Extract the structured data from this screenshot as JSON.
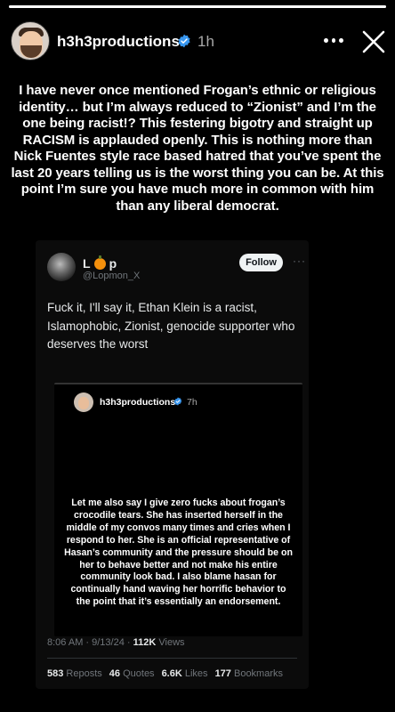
{
  "story": {
    "progress": 1.0,
    "username": "h3h3productions",
    "time": "1h",
    "verified": true,
    "caption": "I have never once mentioned Frogan’s ethnic or religious identity… but I’m always reduced to “Zionist” and I’m the one being racist!? This festering bigotry and straight up RACISM is applauded openly. This is nothing more than Nick Fuentes style race based hatred that you’ve spent the last 20 years telling us is the worst thing you can be. At this point I’m sure you have much more in common with him than any liberal democrat."
  },
  "tweet": {
    "name": "L",
    "name_suffix": "p",
    "handle": "@Lopmon_X",
    "follow_label": "Follow",
    "text": "Fuck it, I'll say it, Ethan Klein is a racist, Islamophobic, Zionist, genocide supporter who deserves the worst",
    "embed": {
      "username": "h3h3productions",
      "time": "7h",
      "text": "Let me also say I give zero fucks about frogan’s crocodile tears. She has inserted herself in the middle of my convos many times and cries when I respond to her. She is an official representative of Hasan’s community and the pressure should be on her to behave better and not make his entire community look bad. I also blame hasan for continually hand waving her horrific behavior to the point that it’s essentially an endorsement."
    },
    "timestamp": "8:06 AM · 9/13/24 · ",
    "views_count": "112K",
    "views_label": " Views",
    "stats": {
      "reposts_count": "583",
      "reposts_label": "Reposts",
      "quotes_count": "46",
      "quotes_label": "Quotes",
      "likes_count": "6.6K",
      "likes_label": "Likes",
      "bookmarks_count": "177",
      "bookmarks_label": "Bookmarks"
    }
  },
  "colors": {
    "background": "#000000",
    "verified_blue": "#3897f0",
    "follow_bg": "#eff3f4",
    "muted": "#71767b"
  },
  "icons": [
    "verified-badge-icon",
    "more-options-icon",
    "close-icon",
    "pumpkin-emoji-icon"
  ]
}
